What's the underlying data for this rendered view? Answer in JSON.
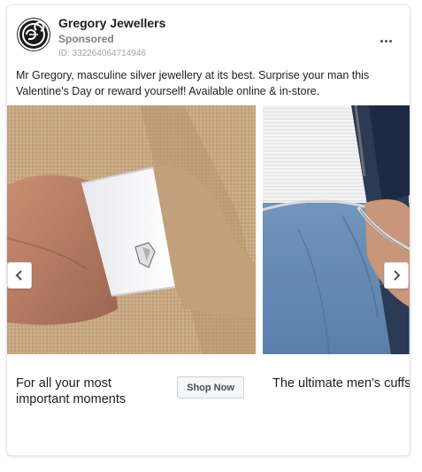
{
  "ad": {
    "brand_name": "Gregory Jewellers",
    "sponsored_label": "Sponsored",
    "ad_id": "ID: 332264064714946",
    "logo_text": "GJ",
    "body_text": "Mr Gregory, masculine silver jewellery at its best. Surprise your man this Valentine's Day or reward yourself! Available online & in-store."
  },
  "carousel": {
    "cards": [
      {
        "image": "cufflink-on-white-cuff-tan-blazer",
        "caption": "For all your most important moments",
        "cta_label": "Shop Now"
      },
      {
        "image": "silver-bracelet-on-wrist-jeans",
        "caption": "The ultimate men's cuffs & bracelets"
      }
    ],
    "prev_icon": "chevron-left-icon",
    "next_icon": "chevron-right-icon"
  },
  "colors": {
    "text": "#1c1e21",
    "secondary_text": "#7b7f85",
    "button_bg": "#f5f6f7",
    "border": "#dddfe2"
  }
}
